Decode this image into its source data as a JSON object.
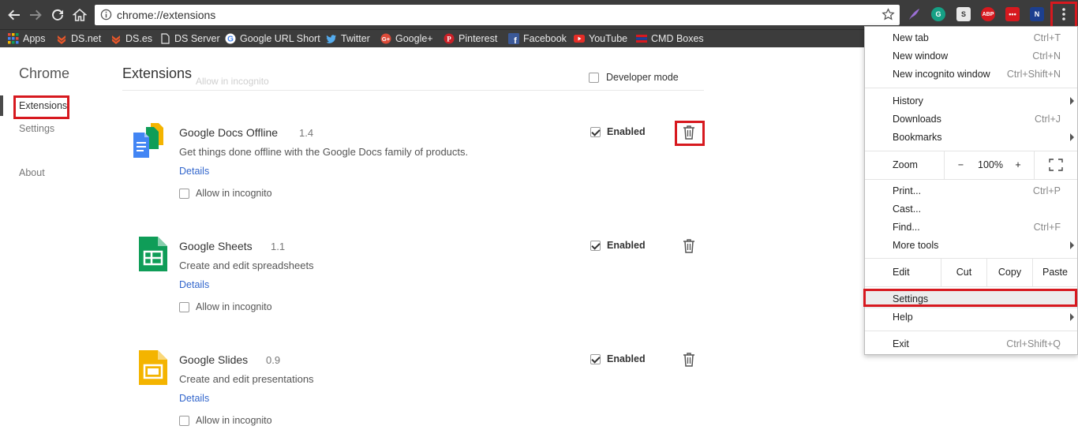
{
  "browser": {
    "url": "chrome://extensions",
    "extensions": [
      {
        "name": "quill-icon",
        "color": "#7b4fb3"
      },
      {
        "name": "grammarly-icon",
        "text": "G",
        "color": "#16a085"
      },
      {
        "name": "s-extension-icon",
        "text": "S",
        "color": "#ffffff"
      },
      {
        "name": "adblock-plus-icon",
        "text": "ABP",
        "color": "#d7191f"
      },
      {
        "name": "lastpass-icon",
        "text": "•••",
        "color": "#d7191f"
      },
      {
        "name": "n-extension-icon",
        "text": "N",
        "color": "#1c3f8f"
      }
    ]
  },
  "bookmarks": [
    {
      "label": "Apps",
      "icon": "apps-grid-icon"
    },
    {
      "label": "DS.net",
      "icon": "chevron-logo-icon"
    },
    {
      "label": "DS.es",
      "icon": "chevron-logo-icon"
    },
    {
      "label": "DS Server",
      "icon": "page-icon"
    },
    {
      "label": "Google URL Short",
      "icon": "google-icon"
    },
    {
      "label": "Twitter",
      "icon": "twitter-icon"
    },
    {
      "label": "Google+",
      "icon": "google-plus-icon"
    },
    {
      "label": "Pinterest",
      "icon": "pinterest-icon"
    },
    {
      "label": "Facebook",
      "icon": "facebook-icon"
    },
    {
      "label": "YouTube",
      "icon": "youtube-icon"
    },
    {
      "label": "CMD Boxes",
      "icon": "stripes-icon"
    }
  ],
  "sidebar": {
    "title": "Chrome",
    "items": [
      {
        "label": "Extensions",
        "active": true
      },
      {
        "label": "Settings"
      },
      {
        "label": "About"
      }
    ]
  },
  "main": {
    "title": "Extensions",
    "ghost_text": "Allow in incognito",
    "developer_mode_label": "Developer mode",
    "extensions": [
      {
        "name": "Google Docs Offline",
        "version": "1.4",
        "description": "Get things done offline with the Google Docs family of products.",
        "details": "Details",
        "incognito": "Allow in incognito",
        "enabled": "Enabled"
      },
      {
        "name": "Google Sheets",
        "version": "1.1",
        "description": "Create and edit spreadsheets",
        "details": "Details",
        "incognito": "Allow in incognito",
        "enabled": "Enabled"
      },
      {
        "name": "Google Slides",
        "version": "0.9",
        "description": "Create and edit presentations",
        "details": "Details",
        "incognito": "Allow in incognito",
        "enabled": "Enabled"
      }
    ]
  },
  "menu": {
    "new_tab": {
      "label": "New tab",
      "shortcut": "Ctrl+T"
    },
    "new_window": {
      "label": "New window",
      "shortcut": "Ctrl+N"
    },
    "new_incognito": {
      "label": "New incognito window",
      "shortcut": "Ctrl+Shift+N"
    },
    "history": {
      "label": "History"
    },
    "downloads": {
      "label": "Downloads",
      "shortcut": "Ctrl+J"
    },
    "bookmarks": {
      "label": "Bookmarks"
    },
    "zoom": {
      "label": "Zoom",
      "minus": "−",
      "value": "100%",
      "plus": "+"
    },
    "print": {
      "label": "Print...",
      "shortcut": "Ctrl+P"
    },
    "cast": {
      "label": "Cast..."
    },
    "find": {
      "label": "Find...",
      "shortcut": "Ctrl+F"
    },
    "more_tools": {
      "label": "More tools"
    },
    "edit": {
      "label": "Edit",
      "cut": "Cut",
      "copy": "Copy",
      "paste": "Paste"
    },
    "settings": {
      "label": "Settings"
    },
    "help": {
      "label": "Help"
    },
    "exit": {
      "label": "Exit",
      "shortcut": "Ctrl+Shift+Q"
    }
  }
}
